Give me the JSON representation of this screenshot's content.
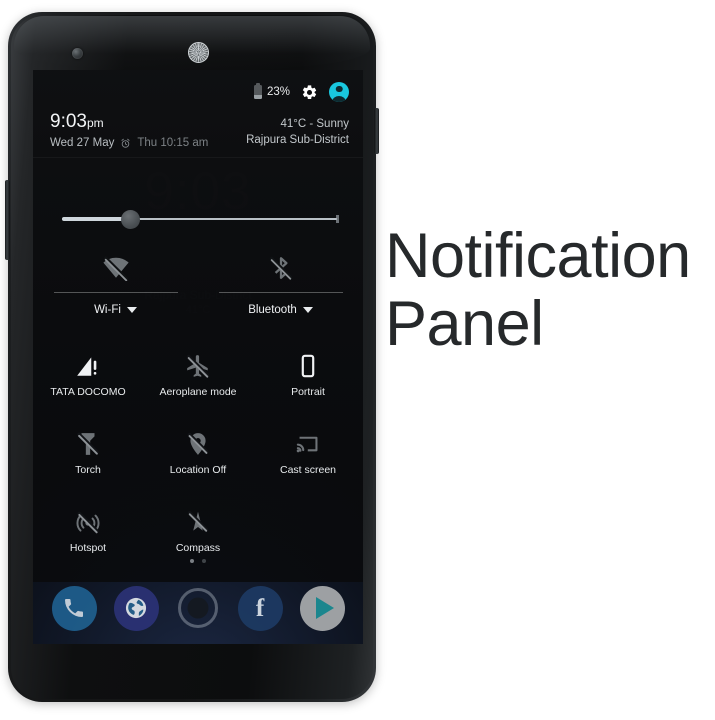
{
  "caption": {
    "text": "Notification\nPanel"
  },
  "device": {
    "name": "android-phone",
    "camera": "front-camera",
    "earpiece": "earpiece-speaker",
    "power_button": "power-button",
    "volume_button": "volume-rocker"
  },
  "status_bar": {
    "battery_icon": "battery-icon",
    "battery_percent": "23%",
    "settings_icon": "gear-icon",
    "user_icon": "user-avatar-icon"
  },
  "header": {
    "time": "9:03",
    "ampm": "pm",
    "date": "Wed 27 May",
    "alarm_icon": "alarm-clock-icon",
    "alarm_time": "Thu 10:15 am",
    "weather": "41°C - Sunny",
    "location": "Rajpura Sub-District"
  },
  "ghost": {
    "clock": "9:03",
    "line1": "Rajpura Sub-District",
    "line2": "41°C"
  },
  "brightness": {
    "label": "brightness-slider",
    "value": 23
  },
  "big_tiles": [
    {
      "label": "Wi-Fi",
      "icon": "wifi-off-icon",
      "state": "off",
      "caret": "chevron-down-icon"
    },
    {
      "label": "Bluetooth",
      "icon": "bluetooth-off-icon",
      "state": "off",
      "caret": "chevron-down-icon"
    }
  ],
  "tiles": [
    {
      "label": "TATA DOCOMO",
      "icon": "cellular-signal-alert-icon"
    },
    {
      "label": "Aeroplane mode",
      "icon": "airplane-off-icon"
    },
    {
      "label": "Portrait",
      "icon": "screen-rotation-portrait-icon"
    },
    {
      "label": "Torch",
      "icon": "flashlight-off-icon"
    },
    {
      "label": "Location Off",
      "icon": "location-off-icon"
    },
    {
      "label": "Cast screen",
      "icon": "cast-screen-icon"
    },
    {
      "label": "Hotspot",
      "icon": "hotspot-off-icon"
    },
    {
      "label": "Compass",
      "icon": "compass-off-icon"
    }
  ],
  "pager": {
    "pages": 2,
    "active": 0
  },
  "dock": [
    {
      "label": "Phone",
      "icon": "phone-icon"
    },
    {
      "label": "Browser",
      "icon": "globe-icon"
    },
    {
      "label": "All apps",
      "icon": "app-drawer-icon"
    },
    {
      "label": "Facebook",
      "icon": "facebook-icon"
    },
    {
      "label": "Play Store",
      "icon": "play-store-icon"
    }
  ],
  "colors": {
    "accent_cyan": "#19c8df",
    "panel_bg": "#0f1012",
    "text_primary": "#f2f4f6",
    "text_secondary": "#b9bec2",
    "caption_text": "#26292b"
  }
}
